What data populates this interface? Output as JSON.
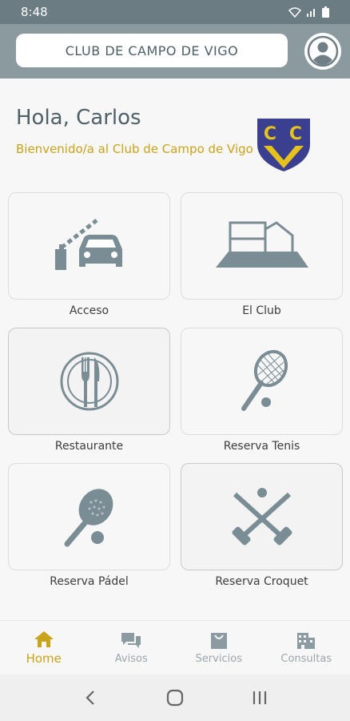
{
  "status_bar": {
    "time": "8:48",
    "icons": [
      "wifi-icon",
      "signal-icon",
      "battery-icon"
    ]
  },
  "header": {
    "title": "CLUB DE CAMPO DE VIGO",
    "avatar_icon": "user-icon"
  },
  "greeting": {
    "hello": "Hola, Carlos",
    "welcome": "Bienvenido/a al Club de Campo de Vigo"
  },
  "crest": {
    "letters": "CCV",
    "colors": {
      "blue": "#3b3f8f",
      "gold": "#e5c21c"
    }
  },
  "tiles": [
    {
      "label": "Acceso",
      "icon": "gate-car-icon"
    },
    {
      "label": "El Club",
      "icon": "clubhouse-icon"
    },
    {
      "label": "Restaurante",
      "icon": "plate-cutlery-icon"
    },
    {
      "label": "Reserva Tenis",
      "icon": "tennis-racket-icon"
    },
    {
      "label": "Reserva Pádel",
      "icon": "padel-racket-icon"
    },
    {
      "label": "Reserva Croquet",
      "icon": "croquet-mallets-icon"
    }
  ],
  "bottom_nav": [
    {
      "label": "Home",
      "icon": "home-icon",
      "active": true
    },
    {
      "label": "Avisos",
      "icon": "chat-icon",
      "active": false
    },
    {
      "label": "Servicios",
      "icon": "bag-icon",
      "active": false
    },
    {
      "label": "Consultas",
      "icon": "building-icon",
      "active": false
    }
  ],
  "system_nav": [
    "back-icon",
    "home-circle-icon",
    "recents-icon"
  ],
  "colors": {
    "accent": "#c9a31a",
    "header": "#8b9a9f",
    "icon": "#7a8d94",
    "text": "#4e6068"
  }
}
